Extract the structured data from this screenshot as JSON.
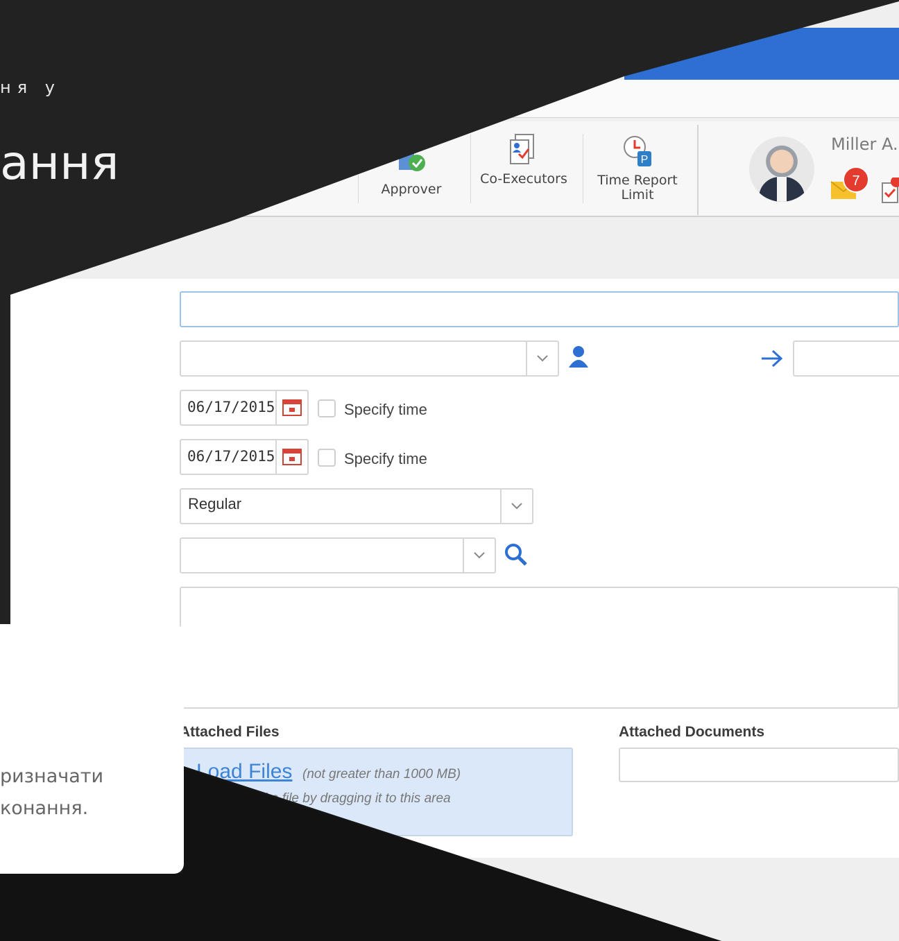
{
  "slide": {
    "kicker": "ня у",
    "title": "ання",
    "card_line1": "ризначати",
    "card_line2": "конання."
  },
  "toolbar": {
    "items": [
      {
        "label": "Approver",
        "icon": "approver-check-icon"
      },
      {
        "label": "Co-Executors",
        "icon": "co-executors-icon"
      },
      {
        "label": "Time Report Limit",
        "icon": "time-report-limit-icon"
      }
    ]
  },
  "user": {
    "name": "Miller A.",
    "unread_count": "7"
  },
  "form": {
    "title_value": "",
    "assignee_value": "",
    "transfer_value": "",
    "start_date": "06/17/2015",
    "end_date": "06/17/2015",
    "specify_time_label": "Specify time",
    "priority_value": "Regular",
    "project_value": "",
    "description_value": ""
  },
  "attachments": {
    "files_title": "Attached Files",
    "documents_title": "Attached Documents",
    "load_files_label": "Load Files",
    "limit_note": "(not greater than 1000 MB)",
    "drag_note": "d a file by dragging it to this area"
  },
  "colors": {
    "accent_blue": "#2d6fd3",
    "badge_red": "#e33b2e",
    "link_blue": "#3d84d6",
    "upload_bg": "#dbe8f9"
  }
}
